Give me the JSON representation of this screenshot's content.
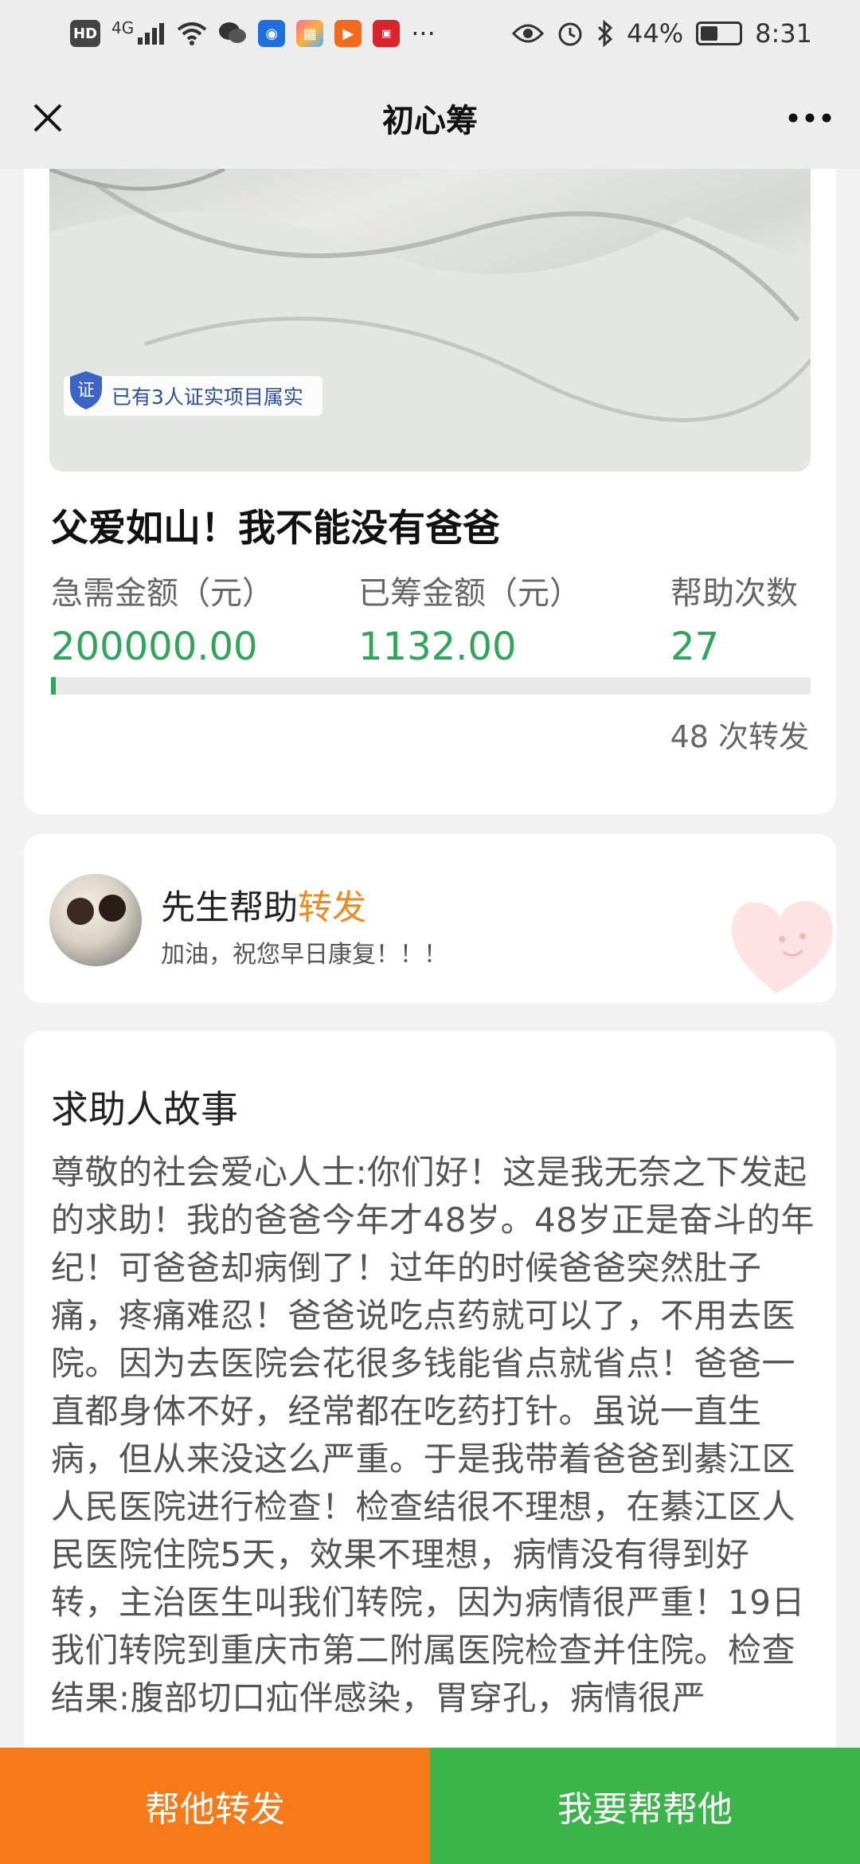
{
  "status_bar": {
    "network": "4G",
    "battery": "44%",
    "time": "8:31",
    "more": "···",
    "icons": [
      "hd-icon",
      "signal-icon",
      "wifi-icon",
      "wechat-icon",
      "app-icon",
      "app-icon",
      "app-icon",
      "app-icon",
      "eye-icon",
      "alarm-icon",
      "bluetooth-icon",
      "battery-icon"
    ]
  },
  "nav": {
    "title": "初心筹"
  },
  "campaign": {
    "verify_badge": "已有3人证实项目属实",
    "verify_icon_text": "证",
    "title": "父爱如山！我不能没有爸爸",
    "stats": [
      {
        "label": "急需金额（元）",
        "value": "200000.00"
      },
      {
        "label": "已筹金额（元）",
        "value": "1132.00"
      },
      {
        "label": "帮助次数",
        "value": "27"
      }
    ],
    "progress_fraction": 0.0057,
    "shares": "48 次转发"
  },
  "supporter": {
    "name": "先生帮助",
    "action": "转发",
    "message": "加油，祝您早日康复！！！"
  },
  "story": {
    "title": "求助人故事",
    "body": "尊敬的社会爱心人士:你们好！这是我无奈之下发起的求助！我的爸爸今年才48岁。48岁正是奋斗的年纪！可爸爸却病倒了！过年的时候爸爸突然肚子痛，疼痛难忍！爸爸说吃点药就可以了，不用去医院。因为去医院会花很多钱能省点就省点！爸爸一直都身体不好，经常都在吃药打针。虽说一直生病，但从来没这么严重。于是我带着爸爸到綦江区人民医院进行检查！检查结很不理想，在綦江区人民医院住院5天，效果不理想，病情没有得到好转，主治医生叫我们转院，因为病情很严重！19日我们转院到重庆市第二附属医院检查并住院。检查结果:腹部切口疝伴感染，胃穿孔，病情很严"
  },
  "bottom": {
    "share_label": "帮他转发",
    "help_label": "我要帮帮他"
  },
  "colors": {
    "accent_green": "#2fa55a",
    "accent_orange": "#f08a1c",
    "share_button": "#f77a1a",
    "help_button": "#3bb54a"
  }
}
